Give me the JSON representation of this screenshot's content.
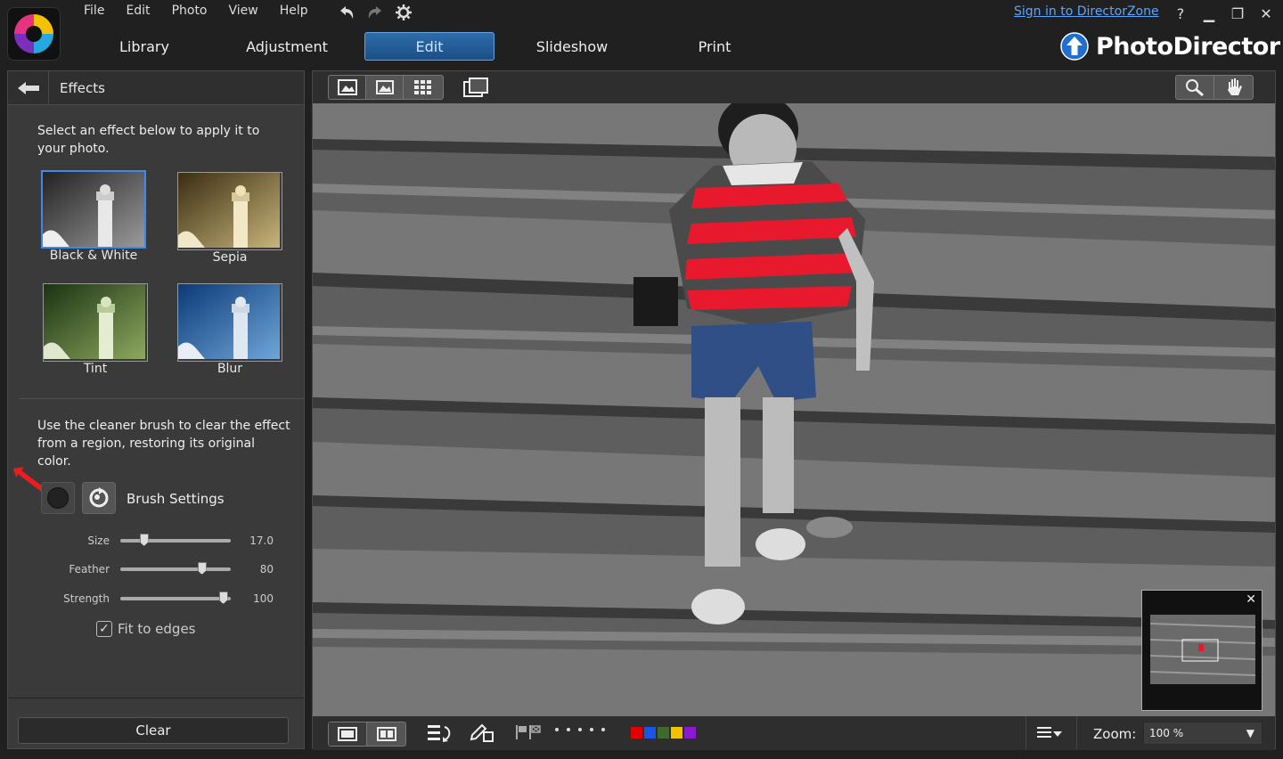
{
  "menu": [
    "File",
    "Edit",
    "Photo",
    "View",
    "Help"
  ],
  "signin": "Sign in to DirectorZone",
  "nav": [
    "Library",
    "Adjustment",
    "Edit",
    "Slideshow",
    "Print"
  ],
  "nav_active": 2,
  "brand": "PhotoDirector",
  "panel": {
    "title": "Effects",
    "intro": "Select an effect below to apply it to your photo.",
    "effects": [
      {
        "label": "Black & White",
        "selected": true,
        "icon": "lighthouse-bw"
      },
      {
        "label": "Sepia",
        "selected": false,
        "icon": "lighthouse-sepia"
      },
      {
        "label": "Tint",
        "selected": false,
        "icon": "lighthouse-tint"
      },
      {
        "label": "Blur",
        "selected": false,
        "icon": "lighthouse-blur"
      }
    ],
    "cleaner_text": "Use the cleaner brush to clear the effect from a region, restoring its original color.",
    "brush_settings": "Brush Settings",
    "sliders": [
      {
        "label": "Size",
        "value": "17.0",
        "fraction": 0.19
      },
      {
        "label": "Feather",
        "value": "80",
        "fraction": 0.76
      },
      {
        "label": "Strength",
        "value": "100",
        "fraction": 0.97
      }
    ],
    "fit_edges": "Fit to edges",
    "fit_edges_checked": true,
    "clear": "Clear"
  },
  "viewer": {
    "zoom_label": "Zoom:",
    "zoom_value": "100 %",
    "color_labels": [
      "#e00000",
      "#1a55e8",
      "#3f6a2a",
      "#f1c200",
      "#8a1ad0"
    ]
  }
}
